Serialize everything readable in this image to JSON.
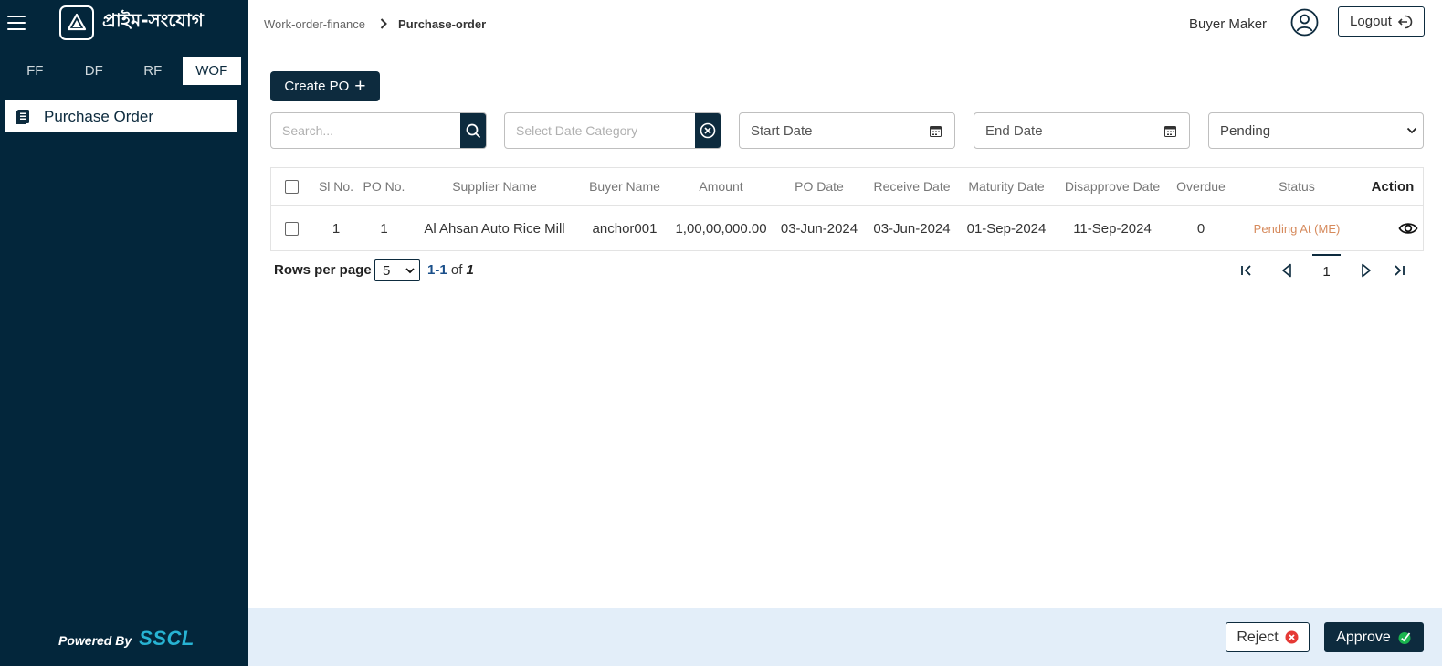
{
  "app": {
    "brand": "প্রাইম-সংযোগ"
  },
  "sidebar": {
    "tabs": [
      {
        "label": "FF"
      },
      {
        "label": "DF"
      },
      {
        "label": "RF"
      },
      {
        "label": "WOF",
        "active": true
      }
    ],
    "menu": [
      {
        "label": "Purchase Order",
        "icon": "document-list-icon"
      }
    ],
    "powered_by": "Powered By",
    "powered_brand": "SSCL"
  },
  "header": {
    "breadcrumb": [
      "Work-order-finance",
      "Purchase-order"
    ],
    "user_name": "Buyer Maker",
    "logout_label": "Logout"
  },
  "toolbar": {
    "create_label": "Create PO",
    "search_placeholder": "Search...",
    "date_category_placeholder": "Select Date Category",
    "start_date_label": "Start Date",
    "end_date_label": "End Date",
    "status_filter": "Pending"
  },
  "table": {
    "columns": [
      "Sl No.",
      "PO No.",
      "Supplier Name",
      "Buyer Name",
      "Amount",
      "PO Date",
      "Receive Date",
      "Maturity Date",
      "Disapprove Date",
      "Overdue",
      "Status",
      "Action"
    ],
    "rows": [
      {
        "sl": "1",
        "po": "1",
        "supplier": "Al Ahsan Auto Rice Mill",
        "buyer": "anchor001",
        "amount": "1,00,00,000.00",
        "po_date": "03-Jun-2024",
        "receive_date": "03-Jun-2024",
        "maturity_date": "01-Sep-2024",
        "disapprove_date": "11-Sep-2024",
        "overdue": "0",
        "status": "Pending At (ME)"
      }
    ]
  },
  "pagination": {
    "rows_per_page_label": "Rows per page",
    "rows_per_page": "5",
    "range": "1-1",
    "of_label": "of",
    "total": "1",
    "current_page": "1"
  },
  "footer": {
    "reject_label": "Reject",
    "approve_label": "Approve"
  },
  "colors": {
    "sidebar_bg": "#03263b",
    "accent": "#0d2b3e",
    "status_pending": "#d68a5c",
    "footer_bg": "#e3eef9",
    "brand_cyan": "#27b3d3"
  }
}
